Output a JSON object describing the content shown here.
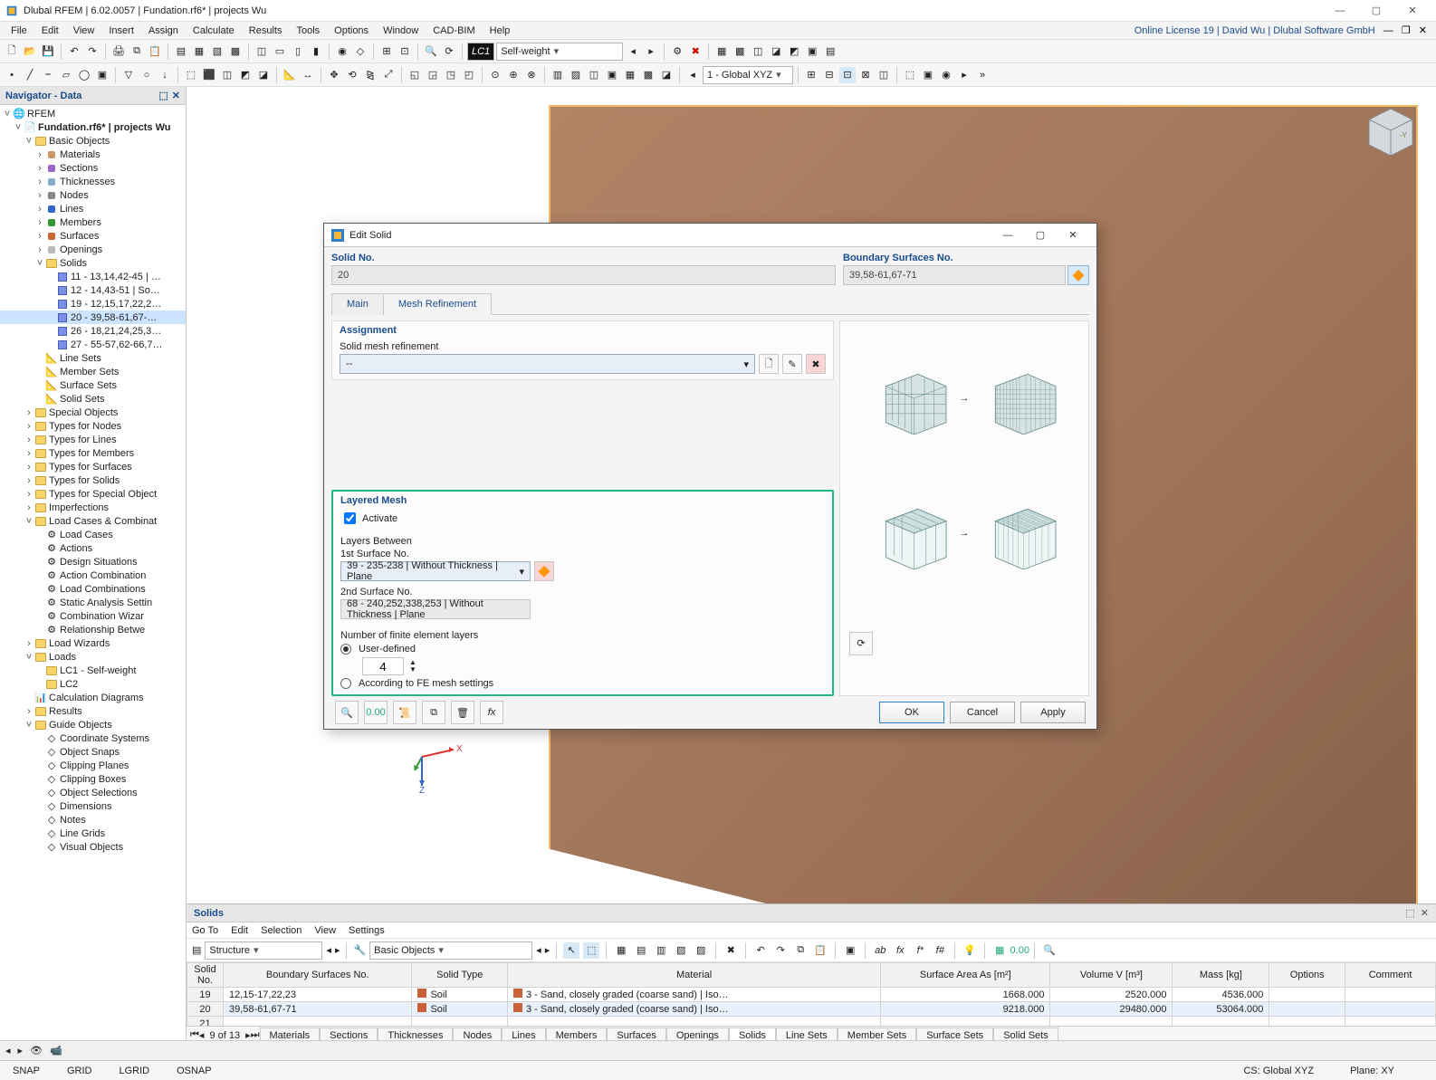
{
  "title": "Dlubal RFEM | 6.02.0057 | Fundation.rf6* | projects Wu",
  "menus": [
    "File",
    "Edit",
    "View",
    "Insert",
    "Assign",
    "Calculate",
    "Results",
    "Tools",
    "Options",
    "Window",
    "CAD-BIM",
    "Help"
  ],
  "license": "Online License 19 | David Wu | Dlubal Software GmbH",
  "lc_code": "LC1",
  "lc_name": "Self-weight",
  "coord_sys": "1 - Global XYZ",
  "navigator": {
    "title": "Navigator - Data",
    "root": "RFEM",
    "project": "Fundation.rf6* | projects Wu",
    "basic_objects": "Basic Objects",
    "items_basic": [
      "Materials",
      "Sections",
      "Thicknesses",
      "Nodes",
      "Lines",
      "Members",
      "Surfaces",
      "Openings",
      "Solids"
    ],
    "solids_children": [
      "11 - 13,14,42-45 | …",
      "12 - 14,43-51 | So…",
      "19 - 12,15,17,22,2…",
      "20 - 39,58-61,67-…",
      "26 - 18,21,24,25,3…",
      "27 - 55-57,62-66,7…"
    ],
    "after_solids": [
      "Line Sets",
      "Member Sets",
      "Surface Sets",
      "Solid Sets"
    ],
    "more_folders": [
      "Special Objects",
      "Types for Nodes",
      "Types for Lines",
      "Types for Members",
      "Types for Surfaces",
      "Types for Solids",
      "Types for Special Object",
      "Imperfections"
    ],
    "lcc": "Load Cases & Combinat",
    "lcc_children": [
      "Load Cases",
      "Actions",
      "Design Situations",
      "Action Combination",
      "Load Combinations",
      "Static Analysis Settin",
      "Combination Wizar",
      "Relationship Betwe"
    ],
    "load_wizards": "Load Wizards",
    "loads": "Loads",
    "loads_children": [
      "LC1 - Self-weight",
      "LC2"
    ],
    "calc_diag": "Calculation Diagrams",
    "results": "Results",
    "guide": "Guide Objects",
    "guide_children": [
      "Coordinate Systems",
      "Object Snaps",
      "Clipping Planes",
      "Clipping Boxes",
      "Object Selections",
      "Dimensions",
      "Notes",
      "Line Grids",
      "Visual Objects"
    ]
  },
  "dialog": {
    "title": "Edit Solid",
    "solid_no_lbl": "Solid No.",
    "solid_no": "20",
    "bsurf_lbl": "Boundary Surfaces No.",
    "bsurf": "39,58-61,67-71",
    "tab_main": "Main",
    "tab_mesh": "Mesh Refinement",
    "assignment": "Assignment",
    "smr_lbl": "Solid mesh refinement",
    "smr_val": "--",
    "layered": "Layered Mesh",
    "activate": "Activate",
    "layers_between": "Layers Between",
    "s1_lbl": "1st Surface No.",
    "s1_val": "39 - 235-238 | Without Thickness | Plane",
    "s2_lbl": "2nd Surface No.",
    "s2_val": "68 - 240,252,338,253 | Without Thickness | Plane",
    "nfel": "Number of finite element layers",
    "radio_user": "User-defined",
    "nlayers": "4",
    "radio_fe": "According to FE mesh settings",
    "ok": "OK",
    "cancel": "Cancel",
    "apply": "Apply"
  },
  "lower": {
    "title": "Solids",
    "menus": [
      "Go To",
      "Edit",
      "Selection",
      "View",
      "Settings"
    ],
    "tool_struct": "Structure",
    "tool_basic": "Basic Objects",
    "headers": [
      "Solid No.",
      "Boundary Surfaces No.",
      "Solid Type",
      "Material",
      "Surface Area As [m²]",
      "Volume V [m³]",
      "Mass [kg]",
      "Options",
      "Comment"
    ],
    "rows": [
      {
        "no": "19",
        "bs": "12,15-17,22,23",
        "type": "Soil",
        "mat": "3 - Sand, closely graded (coarse sand) | Iso…",
        "area": "1668.000",
        "vol": "2520.000",
        "mass": "4536.000"
      },
      {
        "no": "20",
        "bs": "39,58-61,67-71",
        "type": "Soil",
        "mat": "3 - Sand, closely graded (coarse sand) | Iso…",
        "area": "9218.000",
        "vol": "29480.000",
        "mass": "53064.000"
      },
      {
        "no": "21",
        "bs": "",
        "type": "",
        "mat": "",
        "area": "",
        "vol": "",
        "mass": ""
      }
    ],
    "page": "9 of 13",
    "tabs": [
      "Materials",
      "Sections",
      "Thicknesses",
      "Nodes",
      "Lines",
      "Members",
      "Surfaces",
      "Openings",
      "Solids",
      "Line Sets",
      "Member Sets",
      "Surface Sets",
      "Solid Sets"
    ]
  },
  "status": {
    "snap": "SNAP",
    "grid": "GRID",
    "lgrid": "LGRID",
    "osnap": "OSNAP",
    "cs": "CS: Global XYZ",
    "plane": "Plane: XY"
  }
}
